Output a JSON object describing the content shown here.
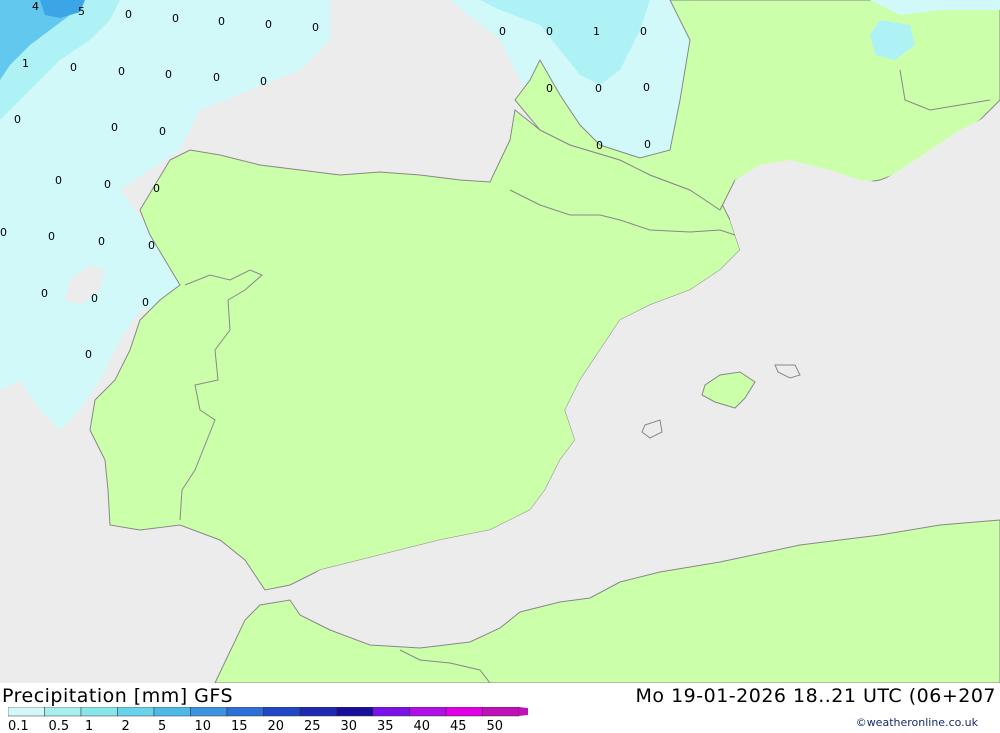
{
  "legend": {
    "title": "Precipitation [mm] GFS",
    "time": "Mo 19-01-2026 18..21 UTC (06+207",
    "ticks": [
      "0.1",
      "0.5",
      "1",
      "2",
      "5",
      "10",
      "15",
      "20",
      "25",
      "30",
      "35",
      "40",
      "45",
      "50"
    ],
    "colors": [
      "#d4f8f8",
      "#a8f0f0",
      "#88e6ea",
      "#68d3ea",
      "#4fb9e6",
      "#3d93e0",
      "#2f6fd8",
      "#2247c4",
      "#1c2ab0",
      "#1a0f9a",
      "#7a12e8",
      "#b010e6",
      "#e000e6",
      "#c010b8"
    ]
  },
  "map": {
    "colors": {
      "sea": "#ececec",
      "land": "#ccffaa",
      "precip_light": "#d2f9fa",
      "precip_mid": "#aff2f6",
      "precip_heavy": "#62c8ee",
      "precip_max": "#3aa6e6",
      "border": "#888888"
    },
    "labels": [
      {
        "t": "4"
      },
      {
        "t": "5"
      },
      {
        "t": "0"
      },
      {
        "t": "0"
      },
      {
        "t": "0"
      },
      {
        "t": "0"
      },
      {
        "t": "0"
      },
      {
        "t": "1"
      },
      {
        "t": "0"
      },
      {
        "t": "0"
      },
      {
        "t": "0"
      },
      {
        "t": "0"
      },
      {
        "t": "0"
      },
      {
        "t": "0"
      },
      {
        "t": "0"
      },
      {
        "t": "0"
      },
      {
        "t": "0"
      },
      {
        "t": "0"
      },
      {
        "t": "0"
      },
      {
        "t": "0"
      },
      {
        "t": "0"
      },
      {
        "t": "0"
      },
      {
        "t": "0"
      },
      {
        "t": "0"
      },
      {
        "t": "0"
      },
      {
        "t": "0"
      },
      {
        "t": "0"
      },
      {
        "t": "0"
      },
      {
        "t": "0"
      },
      {
        "t": "1"
      },
      {
        "t": "0"
      },
      {
        "t": "0"
      },
      {
        "t": "0"
      },
      {
        "t": "0"
      },
      {
        "t": "0"
      },
      {
        "t": "0"
      }
    ]
  },
  "credit": "©weatheronline.co.uk"
}
